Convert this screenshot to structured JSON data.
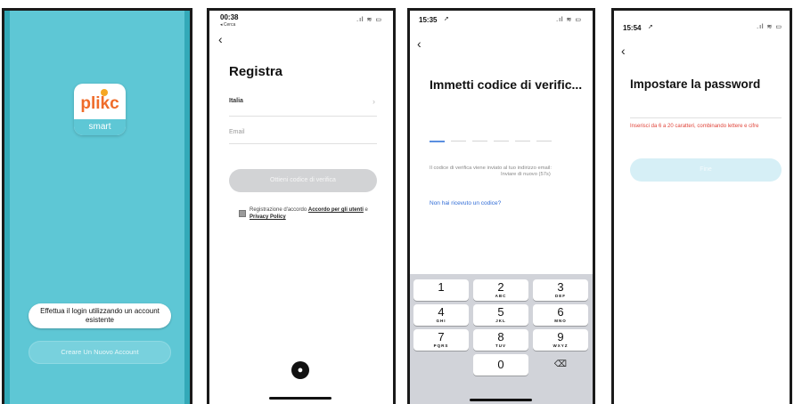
{
  "screen1": {
    "logo": {
      "name": "plikc",
      "sub": "smart"
    },
    "login_button": "Effettua il login utilizzando un account esistente",
    "create_button": "Creare Un Nuovo Account"
  },
  "screen2": {
    "time": "00:38",
    "back_app": "◂ Cerca",
    "title": "Registra",
    "country": "Italia",
    "email_placeholder": "Email",
    "get_code_button": "Ottieni codice di verifica",
    "agreement_prefix": "Registrazione d'accordo ",
    "agreement_link1": "Accordo per gli utenti",
    "agreement_and": " e ",
    "agreement_link2": "Privacy Policy"
  },
  "screen3": {
    "time": "15:35",
    "title": "Immetti codice di verific...",
    "info_text": "Il codice di verifica viene inviato al tuo indirizzo email:",
    "resend_text": "Inviare di nuovo (57s)",
    "not_received": "Non hai ricevuto un codice?",
    "keypad": [
      {
        "d": "1",
        "l": ""
      },
      {
        "d": "2",
        "l": "ABC"
      },
      {
        "d": "3",
        "l": "DEF"
      },
      {
        "d": "4",
        "l": "GHI"
      },
      {
        "d": "5",
        "l": "JKL"
      },
      {
        "d": "6",
        "l": "MNO"
      },
      {
        "d": "7",
        "l": "PQRS"
      },
      {
        "d": "8",
        "l": "TUV"
      },
      {
        "d": "9",
        "l": "WXYZ"
      },
      {
        "d": "0",
        "l": ""
      }
    ]
  },
  "screen4": {
    "time": "15:54",
    "title": "Impostare la password",
    "hint": "Inserisci da 6 a 20 caratteri, combinando lettere e cifre",
    "done_button": "Fine"
  },
  "colors": {
    "teal_bg": "#5ec7d5",
    "teal_dark": "#33a9b8",
    "accent_blue": "#2f6bd6",
    "disabled_button": "#cfd0d2",
    "light_blue_button": "#d6eff6",
    "error_red": "#e0443a",
    "logo_orange": "#f5a623"
  }
}
